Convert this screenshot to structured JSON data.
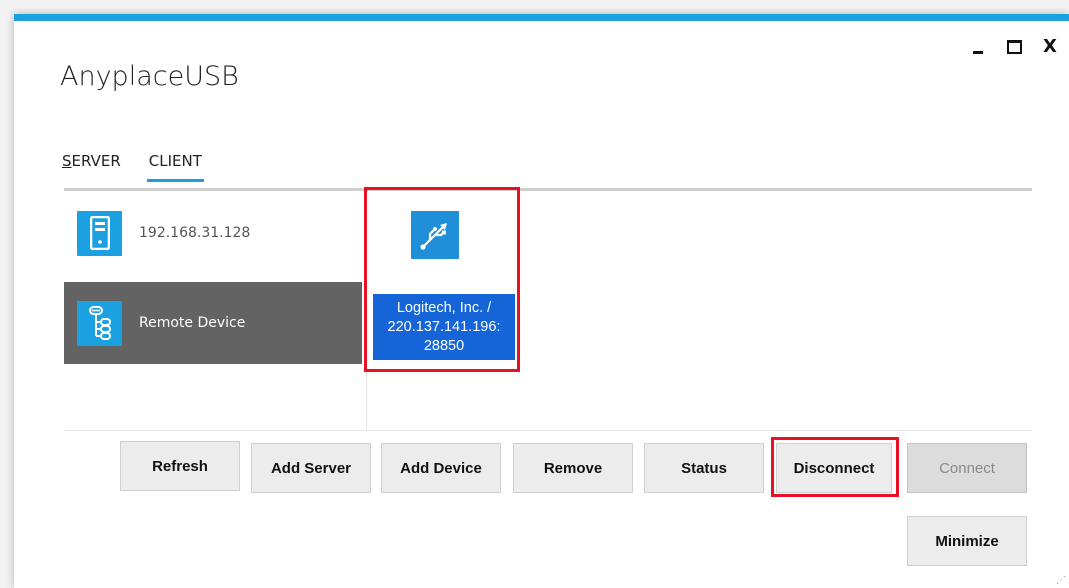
{
  "window": {
    "title": "AnyplaceUSB",
    "controls": {
      "minimize": "_",
      "maximize": "□",
      "close": "X"
    }
  },
  "tabs": [
    {
      "label": "SERVER",
      "access_key": "S",
      "rest": "ERVER",
      "active": false
    },
    {
      "label": "CLIENT",
      "active": true
    }
  ],
  "tree": {
    "items": [
      {
        "label": "192.168.31.128",
        "icon": "server-tower-icon",
        "selected": false
      },
      {
        "label": "Remote Device",
        "icon": "device-tree-icon",
        "selected": true
      }
    ]
  },
  "devices": [
    {
      "line1": "Logitech, Inc. /",
      "line2": "220.137.141.196:",
      "line3": "28850",
      "icon": "usb-icon",
      "selected": true,
      "highlighted": true
    }
  ],
  "toolbar": {
    "refresh": "Refresh",
    "add_server": "Add Server",
    "add_device": "Add Device",
    "remove": "Remove",
    "status": "Status",
    "disconnect": "Disconnect",
    "connect": "Connect",
    "minimize": "Minimize"
  },
  "states": {
    "connect_enabled": false,
    "disconnect_highlighted": true
  },
  "colors": {
    "accent": "#1ba1e2",
    "selection": "#1565d8",
    "selected_row": "#636363",
    "highlight_frame": "#e81123"
  }
}
